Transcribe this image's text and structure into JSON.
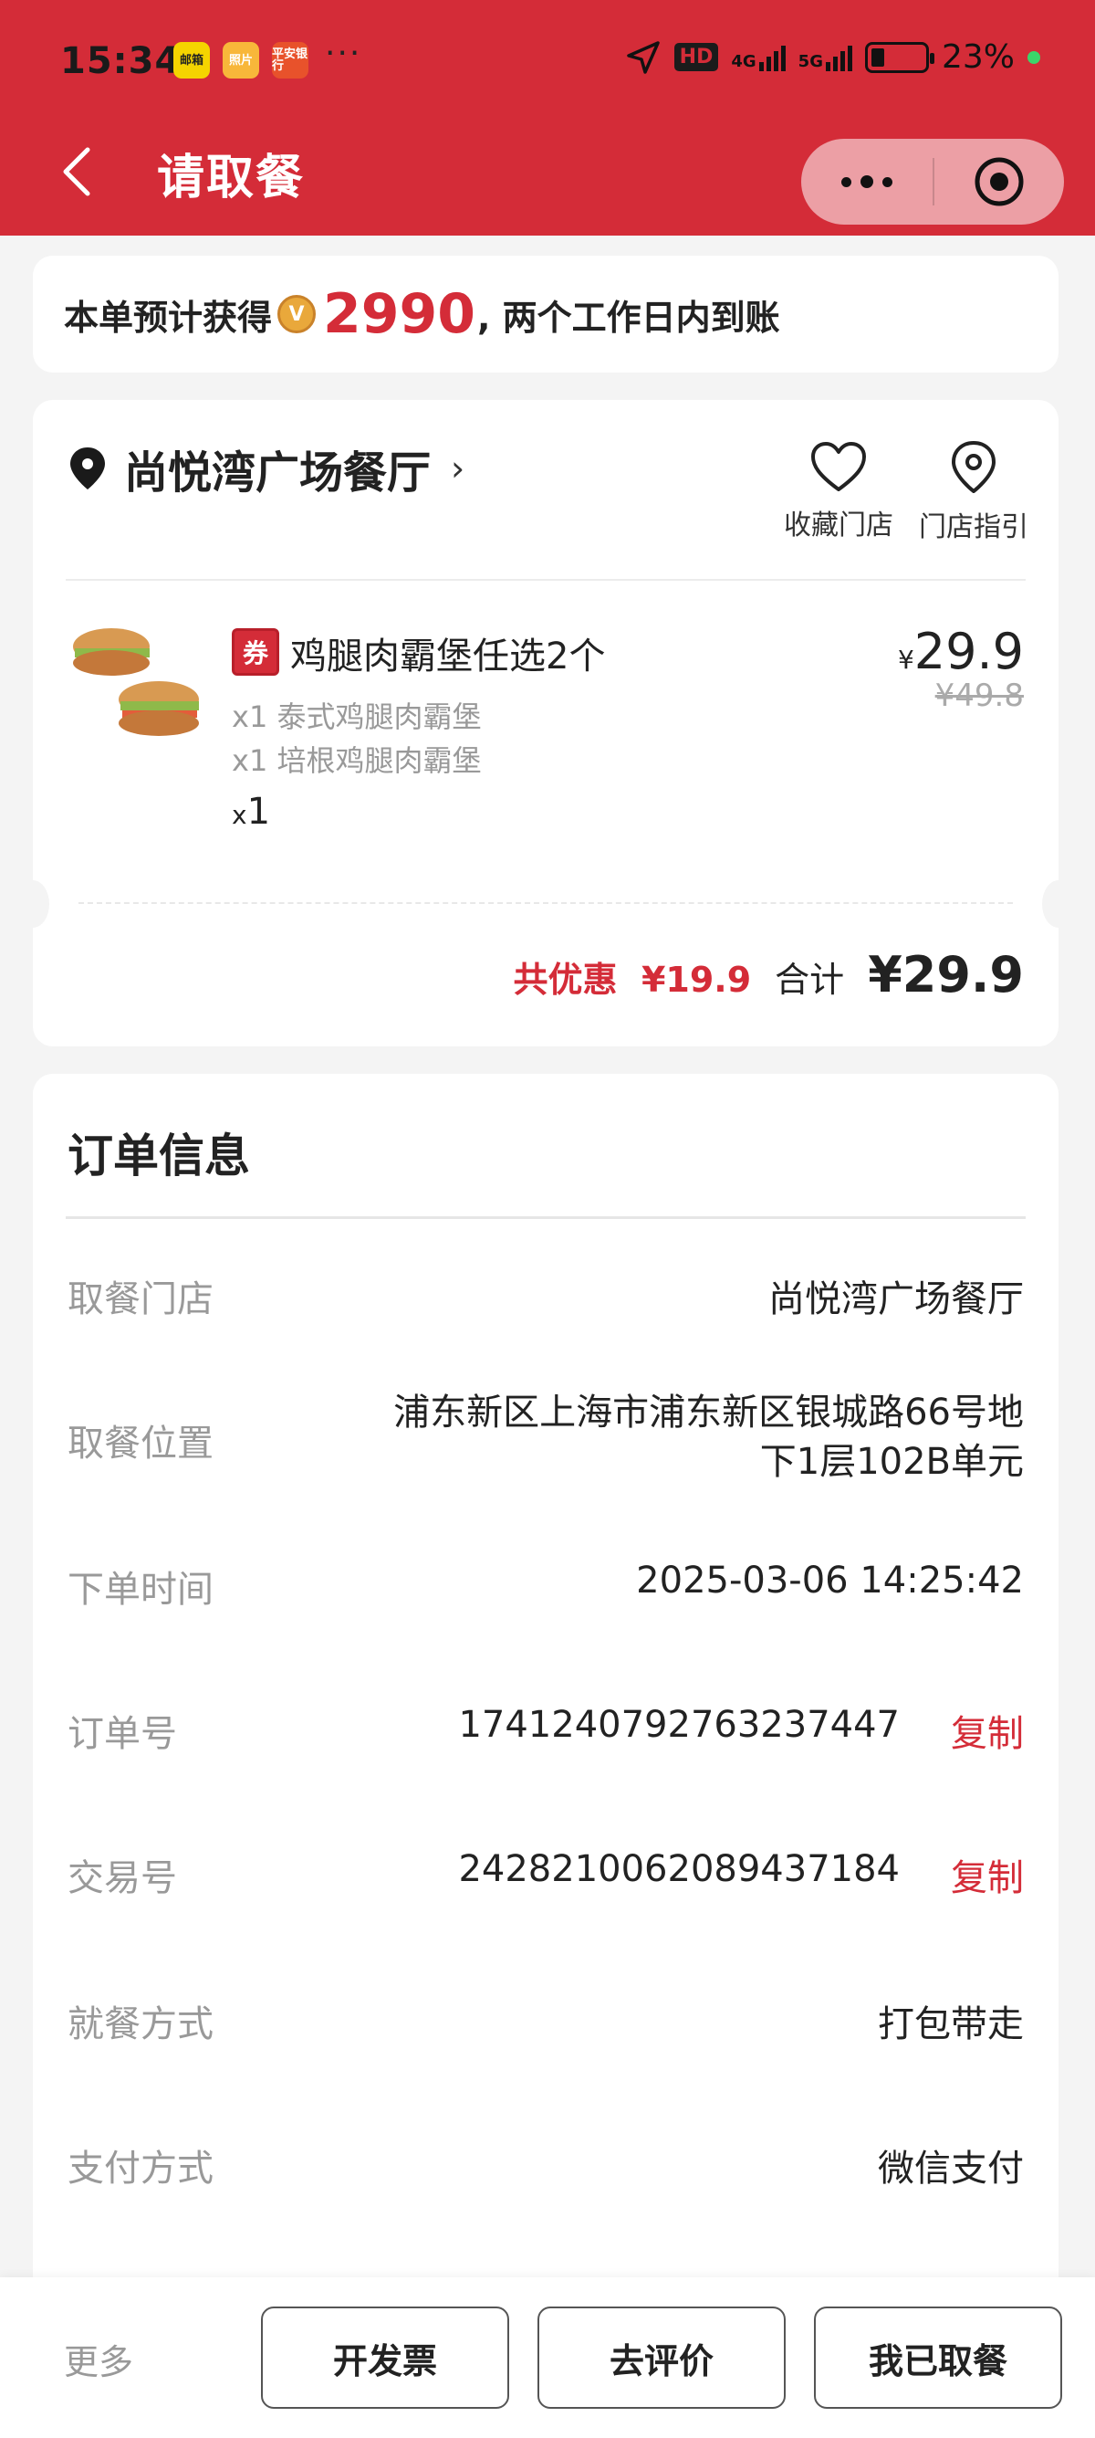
{
  "status_bar": {
    "time": "15:34",
    "app_icons": [
      "邮箱",
      "照片",
      "平安银行"
    ],
    "more_dots": "···",
    "hd_badge": "HD",
    "network_4g": "4G",
    "network_5g": "5G",
    "battery_percent": "23%",
    "battery_level": 0.23
  },
  "header": {
    "title": "请取餐",
    "background_color": "#d42c38"
  },
  "points_banner": {
    "prefix": "本单预计获得",
    "coin_letter": "V",
    "points": "2990",
    "suffix": ", 两个工作日内到账"
  },
  "store": {
    "name": "尚悦湾广场餐厅",
    "favorite_label": "收藏门店",
    "guide_label": "门店指引"
  },
  "order_item": {
    "coupon_tag": "券",
    "name": "鸡腿肉霸堡任选2个",
    "options": [
      "x1 泰式鸡腿肉霸堡",
      "x1 培根鸡腿肉霸堡"
    ],
    "qty_prefix": "x",
    "qty": "1",
    "currency": "¥",
    "price": "29.9",
    "original_price": "¥49.8"
  },
  "totals": {
    "discount_label": "共优惠",
    "discount_value": "¥19.9",
    "total_label": "合计",
    "total_value": "¥29.9"
  },
  "order_info": {
    "title": "订单信息",
    "rows": [
      {
        "label": "取餐门店",
        "value": "尚悦湾广场餐厅"
      },
      {
        "label": "取餐位置",
        "value_line1": "浦东新区上海市浦东新区银城路66号地",
        "value_line2": "下1层102B单元"
      },
      {
        "label": "下单时间",
        "value": "2025-03-06 14:25:42"
      },
      {
        "label": "订单号",
        "value": "1741240792763237447",
        "action": "复制"
      },
      {
        "label": "交易号",
        "value": "2428210062089437184",
        "action": "复制"
      },
      {
        "label": "就餐方式",
        "value": "打包带走"
      },
      {
        "label": "支付方式",
        "value": "微信支付"
      }
    ]
  },
  "bottom_bar": {
    "more_label": "更多",
    "invoice_label": "开发票",
    "review_label": "去评价",
    "picked_up_label": "我已取餐"
  }
}
